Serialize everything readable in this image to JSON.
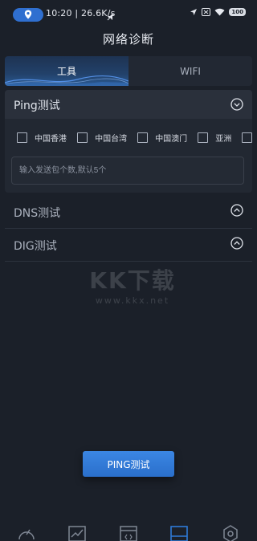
{
  "status_bar": {
    "text": "10:20 | 26.6K/s",
    "battery": "100"
  },
  "page": {
    "title": "网络诊断"
  },
  "tabs": [
    {
      "label": "工具",
      "active": true
    },
    {
      "label": "WIFI",
      "active": false
    }
  ],
  "ping": {
    "title": "Ping测试",
    "regions": [
      "中国香港",
      "中国台湾",
      "中国澳门",
      "亚洲",
      ""
    ],
    "count_placeholder": "输入发送包个数,默认5个",
    "button_label": "PING测试"
  },
  "dns": {
    "title": "DNS测试"
  },
  "dig": {
    "title": "DIG测试"
  },
  "watermark": {
    "main": "KK下载",
    "url": "www.kkx.net"
  },
  "colors": {
    "accent": "#2f7ad8",
    "background": "#1b2029",
    "panel": "#222832"
  },
  "nav": [
    "speedometer-icon",
    "chart-icon",
    "browser-icon",
    "diagnose-icon",
    "settings-icon"
  ]
}
